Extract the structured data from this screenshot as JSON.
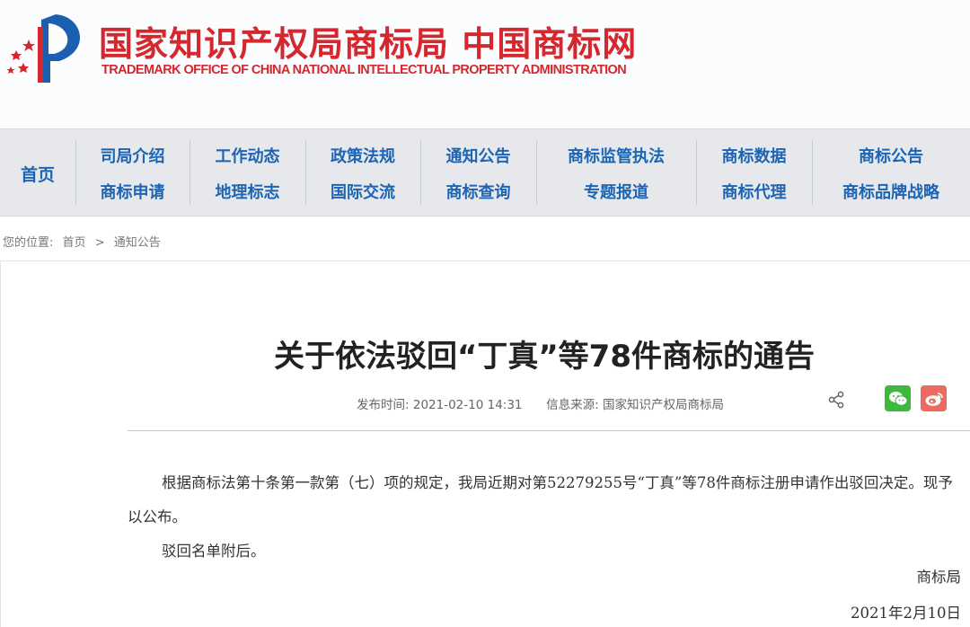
{
  "header": {
    "title_cn": "国家知识产权局商标局 中国商标网",
    "title_en": "TRADEMARK OFFICE OF CHINA NATIONAL INTELLECTUAL PROPERTY ADMINISTRATION"
  },
  "nav": {
    "home": "首页",
    "columns": [
      [
        "司局介绍",
        "商标申请"
      ],
      [
        "工作动态",
        "地理标志"
      ],
      [
        "政策法规",
        "国际交流"
      ],
      [
        "通知公告",
        "商标查询"
      ],
      [
        "商标监管执法",
        "专题报道"
      ],
      [
        "商标数据",
        "商标代理"
      ],
      [
        "商标公告",
        "商标品牌战略"
      ]
    ]
  },
  "breadcrumb": {
    "label": "您的位置:",
    "home": "首页",
    "sep": ">",
    "current": "通知公告"
  },
  "article": {
    "title": "关于依法驳回“丁真”等78件商标的通告",
    "publish_label": "发布时间:",
    "publish_time": "2021-02-10 14:31",
    "source_label": "信息来源:",
    "source": "国家知识产权局商标局",
    "paragraph1": "根据商标法第十条第一款第（七）项的规定，我局近期对第52279255号“丁真”等78件商标注册申请作出驳回决定。现予以公布。",
    "paragraph2": "驳回名单附后。",
    "signer": "商标局",
    "date": "2021年2月10日"
  },
  "colors": {
    "brand_red": "#d4282e",
    "nav_blue": "#1d64b3",
    "nav_bg": "#e6e8ec",
    "wechat_green": "#3db93e",
    "weibo_red": "#ec6b5e"
  }
}
